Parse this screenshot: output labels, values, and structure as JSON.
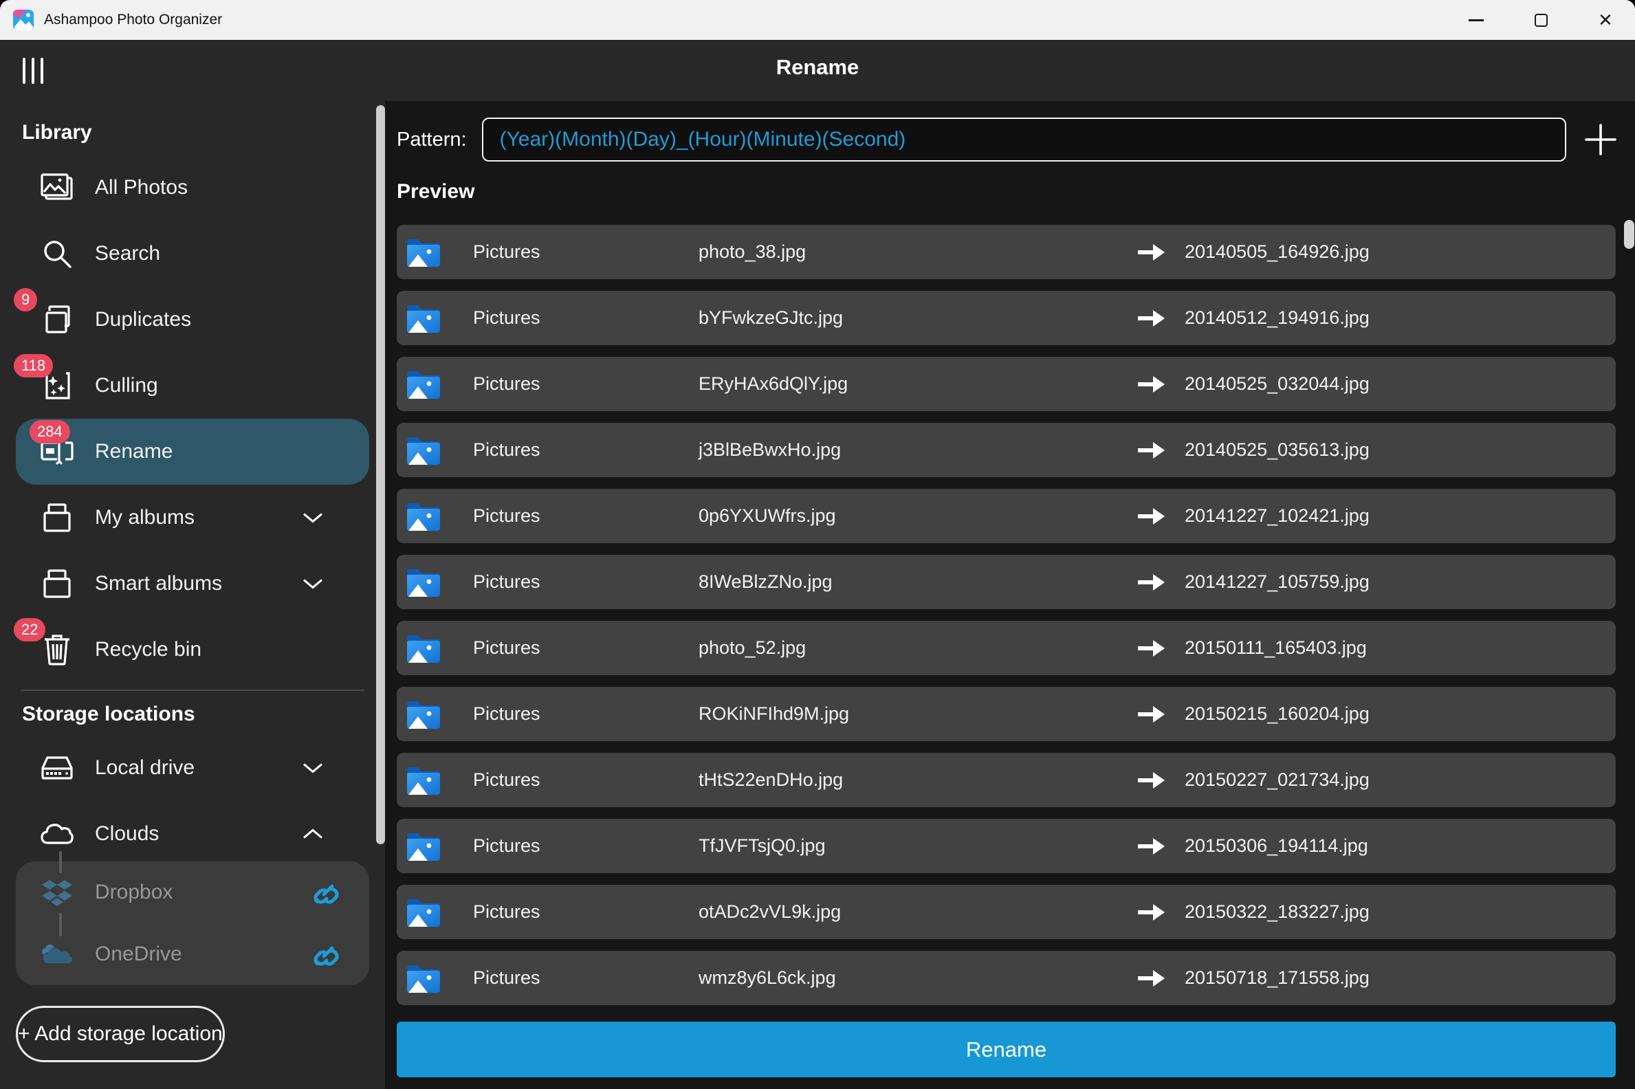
{
  "window": {
    "title": "Ashampoo Photo Organizer",
    "controls": {
      "minimize": "minimize",
      "maximize": "maximize",
      "close": "✕"
    }
  },
  "header": {
    "title": "Rename"
  },
  "sidebar": {
    "library": {
      "header": "Library",
      "items": [
        {
          "label": "All Photos"
        },
        {
          "label": "Search"
        },
        {
          "label": "Duplicates",
          "badge": "9"
        },
        {
          "label": "Culling",
          "badge": "118"
        },
        {
          "label": "Rename",
          "badge": "284",
          "selected": true
        },
        {
          "label": "My albums",
          "chevron": "down"
        },
        {
          "label": "Smart albums",
          "chevron": "down"
        },
        {
          "label": "Recycle bin",
          "badge": "22"
        }
      ]
    },
    "storage": {
      "header": "Storage locations",
      "local_drive": {
        "label": "Local drive",
        "chevron": "down"
      },
      "clouds": {
        "label": "Clouds",
        "chevron": "up"
      },
      "cloud_children": [
        {
          "label": "Dropbox",
          "linked": true
        },
        {
          "label": "OneDrive",
          "linked": true
        }
      ]
    },
    "add_button": "+ Add storage location"
  },
  "main": {
    "pattern": {
      "label": "Pattern:",
      "value": "(Year)(Month)(Day)_(Hour)(Minute)(Second)"
    },
    "preview": {
      "header": "Preview",
      "rows": [
        {
          "folder": "Pictures",
          "old_name": "photo_38.jpg",
          "new_name": "20140505_164926.jpg"
        },
        {
          "folder": "Pictures",
          "old_name": "bYFwkzeGJtc.jpg",
          "new_name": "20140512_194916.jpg"
        },
        {
          "folder": "Pictures",
          "old_name": "ERyHAx6dQlY.jpg",
          "new_name": "20140525_032044.jpg"
        },
        {
          "folder": "Pictures",
          "old_name": "j3BlBeBwxHo.jpg",
          "new_name": "20140525_035613.jpg"
        },
        {
          "folder": "Pictures",
          "old_name": "0p6YXUWfrs.jpg",
          "new_name": "20141227_102421.jpg"
        },
        {
          "folder": "Pictures",
          "old_name": "8IWeBlzZNo.jpg",
          "new_name": "20141227_105759.jpg"
        },
        {
          "folder": "Pictures",
          "old_name": "photo_52.jpg",
          "new_name": "20150111_165403.jpg"
        },
        {
          "folder": "Pictures",
          "old_name": "ROKiNFIhd9M.jpg",
          "new_name": "20150215_160204.jpg"
        },
        {
          "folder": "Pictures",
          "old_name": "tHtS22enDHo.jpg",
          "new_name": "20150227_021734.jpg"
        },
        {
          "folder": "Pictures",
          "old_name": "TfJVFTsjQ0.jpg",
          "new_name": "20150306_194114.jpg"
        },
        {
          "folder": "Pictures",
          "old_name": "otADc2vVL9k.jpg",
          "new_name": "20150322_183227.jpg"
        },
        {
          "folder": "Pictures",
          "old_name": "wmz8y6L6ck.jpg",
          "new_name": "20150718_171558.jpg"
        }
      ]
    },
    "rename_button": "Rename"
  },
  "colors": {
    "accent_blue": "#1e9cd8",
    "rename_button": "#1798d4",
    "badge_red": "#e8495f",
    "selected_item": "#2e5768",
    "sidebar_bg": "#282828",
    "content_bg": "#161616",
    "row_bg": "#424242",
    "titlebar_bg": "#f1f1f1"
  }
}
